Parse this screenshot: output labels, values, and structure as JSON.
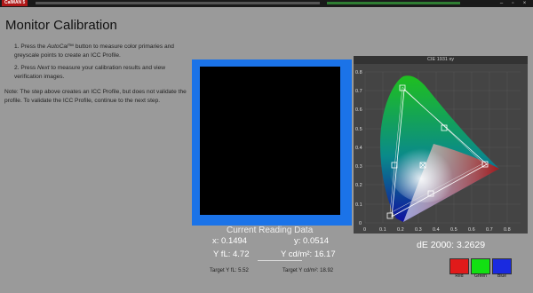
{
  "window": {
    "logo": "CalMAN 5"
  },
  "page_title": "Monitor Calibration",
  "instructions": {
    "step1_pre": "1.  Press the ",
    "step1_em": "AutoCal™",
    "step1_post": " button to measure color primaries and greyscale points to create an ICC Profile.",
    "step2_pre": "2.  Press ",
    "step2_em": "Next",
    "step2_post": " to measure your calibration results and view verification images."
  },
  "note": "Note: The step above creates an ICC Profile, but does not validate the profile.  To validate the ICC Profile, continue to the next step.",
  "reading": {
    "title": "Current Reading Data",
    "x": "x: 0.1494",
    "y": "y: 0.0514",
    "yfl": "Y fL: 4.72",
    "ycd": "Y cd/m²: 16.17",
    "target_yfl": "Target Y fL: 5.52",
    "target_ycd": "Target Y cd/m²: 18.92"
  },
  "cie": {
    "title": "CIE 1931 xy",
    "y_ticks": [
      "0.8",
      "0.7",
      "0.6",
      "0.5",
      "0.4",
      "0.3",
      "0.2",
      "0.1",
      "0"
    ],
    "x_ticks": [
      "0",
      "0.1",
      "0.2",
      "0.3",
      "0.4",
      "0.5",
      "0.6",
      "0.7",
      "0.8"
    ]
  },
  "de2000": "dE 2000: 3.2629",
  "swatches": [
    {
      "label": "Red",
      "color": "#e11a1a"
    },
    {
      "label": "Green",
      "color": "#12e012"
    },
    {
      "label": "Blue",
      "color": "#1a2ae0"
    }
  ],
  "colors": {
    "accent": "#1b73e8",
    "background": "#9a9a9a"
  }
}
